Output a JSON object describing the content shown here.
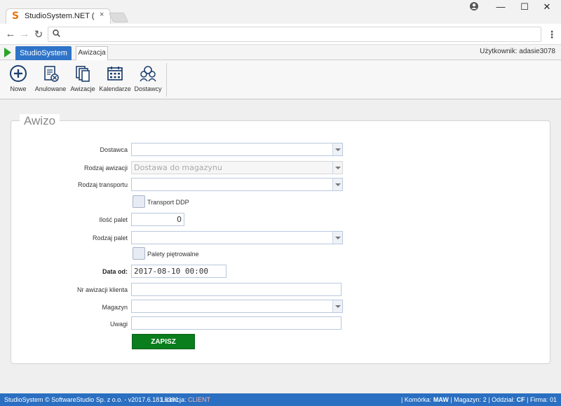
{
  "browser": {
    "tab_title": "StudioSystem.NET (c) So",
    "tab_close": "×",
    "url": ""
  },
  "app": {
    "main_tab": "StudioSystem",
    "sub_tab": "Awizacja",
    "user_info": "Użytkownik: adasie3078"
  },
  "ribbon": {
    "nowe": "Nowe",
    "anulowane": "Anulowane",
    "awizacje": "Awizacje",
    "kalendarze": "Kalendarze",
    "dostawcy": "Dostawcy"
  },
  "form": {
    "title": "Awizo",
    "dostawca_label": "Dostawca",
    "dostawca_value": "",
    "rodzaj_awizacji_label": "Rodzaj awizacji",
    "rodzaj_awizacji_value": "Dostawa do magazynu",
    "rodzaj_transportu_label": "Rodzaj transportu",
    "rodzaj_transportu_value": "",
    "transport_ddp_label": "Transport DDP",
    "ilosc_palet_label": "Ilość palet",
    "ilosc_palet_value": "0",
    "rodzaj_palet_label": "Rodzaj palet",
    "rodzaj_palet_value": "",
    "palety_label": "Palety piętrowalne",
    "data_od_label": "Data od:",
    "data_od_value": "2017-08-10 00:00",
    "nr_awizacji_label": "Nr awizacji klienta",
    "nr_awizacji_value": "",
    "magazyn_label": "Magazyn",
    "magazyn_value": "",
    "uwagi_label": "Uwagi",
    "uwagi_value": "",
    "save_label": "ZAPISZ"
  },
  "status": {
    "left": "StudioSystem © SoftwareStudio Sp. z o.o. - v2017.6.181.6391",
    "licencja_label": "Licencja:",
    "licencja_value": "CLIENT",
    "komorka_label": "| Komórka:",
    "komorka_value": "MAW",
    "magazyn_label": "| Magazyn:",
    "magazyn_value": "2",
    "oddzial_label": "| Oddział:",
    "oddzial_value": "CF",
    "firma_label": "| Firma:",
    "firma_value": "01"
  },
  "colors": {
    "accent": "#2f74c8",
    "save": "#0a7d1c",
    "status_bar": "#2a6fc1"
  }
}
